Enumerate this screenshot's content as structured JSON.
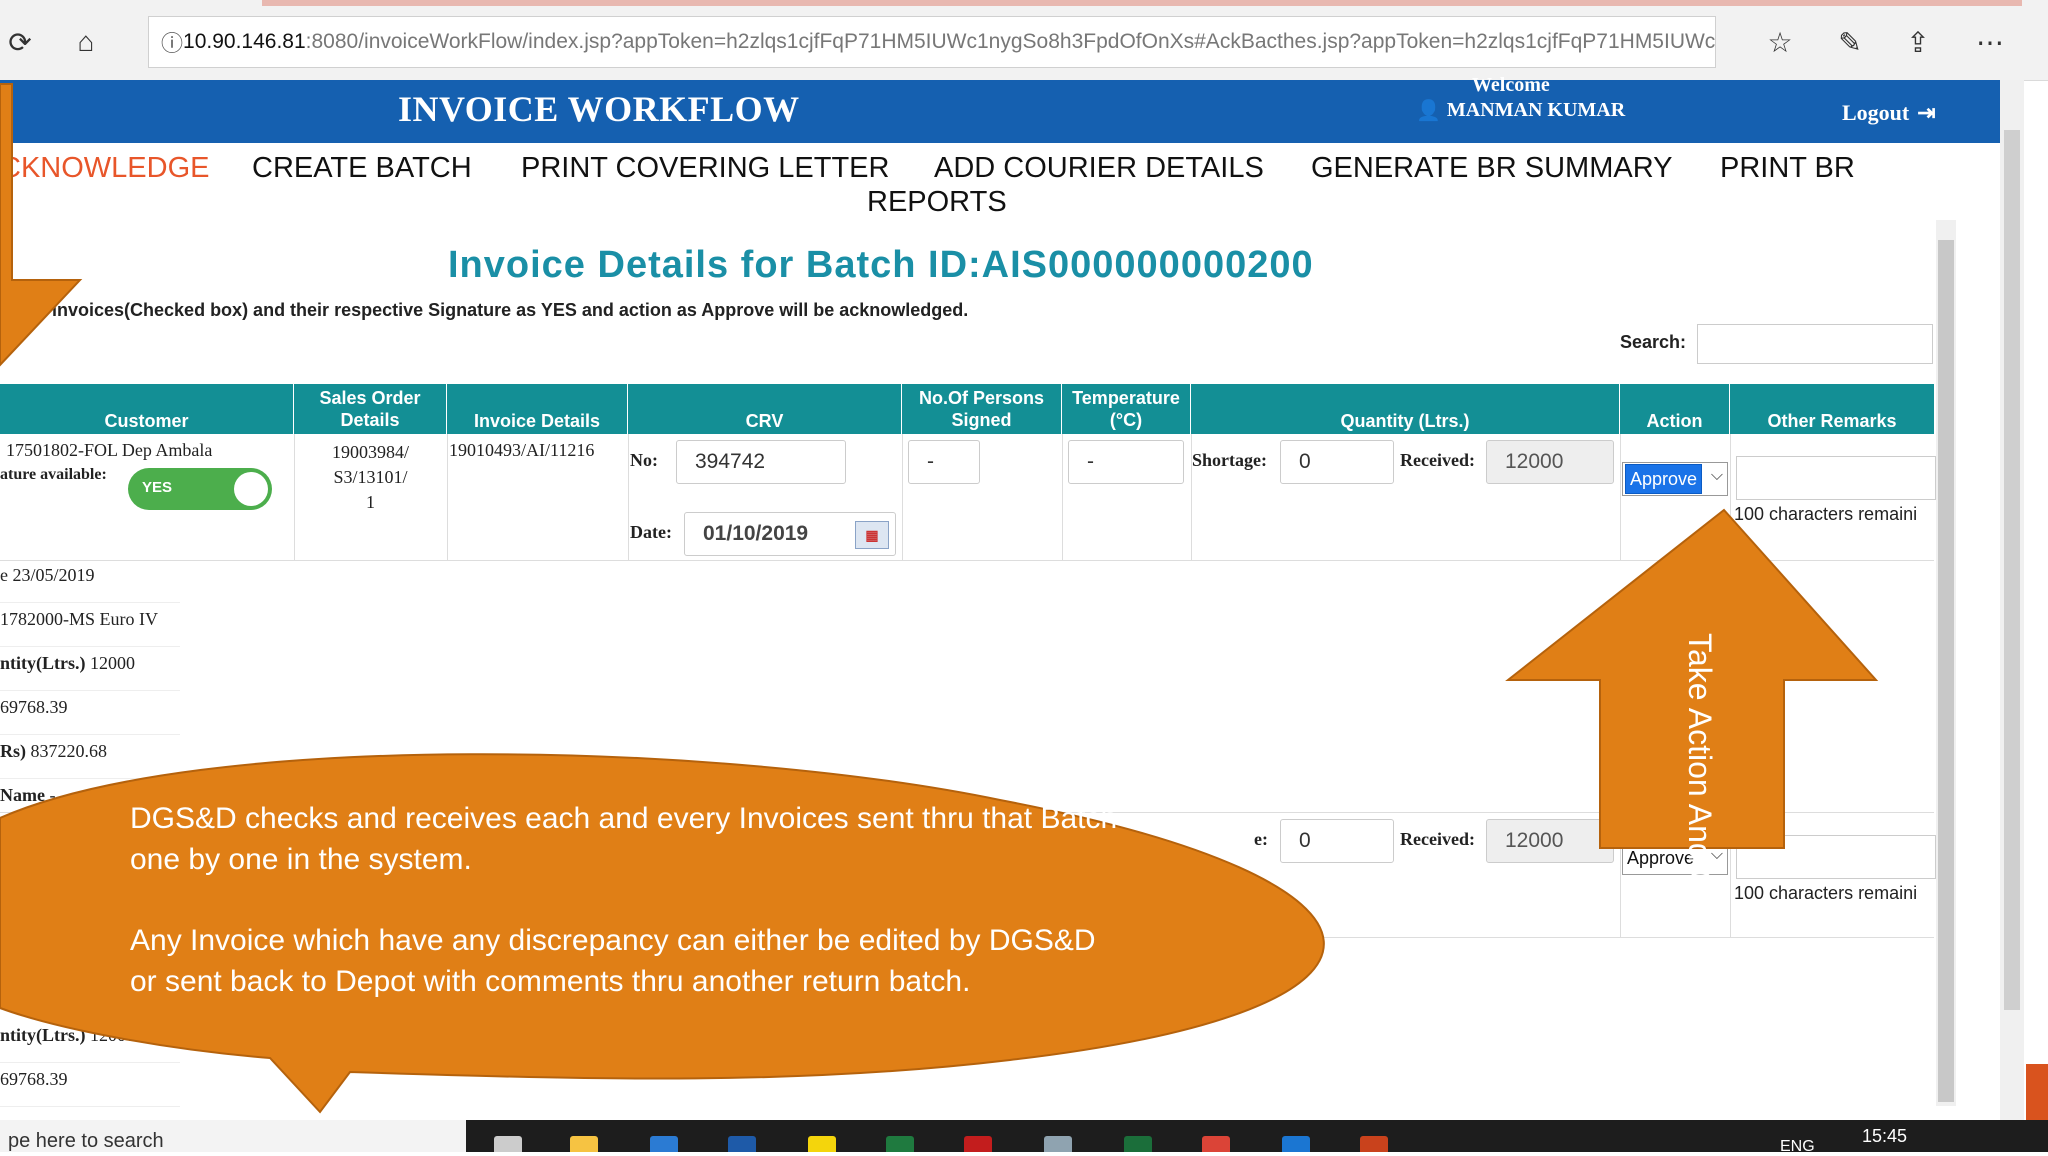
{
  "browser": {
    "url_host": "10.90.146.81",
    "url_rest": ":8080/invoiceWorkFlow/index.jsp?appToken=h2zlqs1cjfFqP71HM5IUWc1nygSo8h3FpdOfOnXs#AckBacthes.jsp?appToken=h2zlqs1cjfFqP71HM5IUWc1r",
    "icons": [
      "refresh-icon",
      "home-icon",
      "info-icon",
      "favorites-icon",
      "pen-icon",
      "share-icon",
      "more-icon"
    ]
  },
  "header": {
    "title": "INVOICE WORKFLOW",
    "welcome": "Welcome",
    "user": "MANMAN KUMAR",
    "logout": "Logout"
  },
  "nav": {
    "items": [
      "CKNOWLEDGE",
      "CREATE BATCH",
      "PRINT COVERING LETTER",
      "ADD COURIER DETAILS",
      "GENERATE BR SUMMARY",
      "PRINT BR",
      "REPORTS"
    ]
  },
  "page": {
    "heading": "Invoice Details for Batch ID:AIS000000000200",
    "instruction": "invoices(Checked box) and their respective Signature as YES and action as Approve will be acknowledged.",
    "search_label": "Search:"
  },
  "table": {
    "headers": [
      "Customer",
      "Sales Order Details",
      "Invoice Details",
      "CRV",
      "No.Of Persons Signed",
      "Temperature (°C)",
      "Quantity (Ltrs.)",
      "Action",
      "Other Remarks"
    ],
    "row1": {
      "customer": "17501802-FOL Dep Ambala",
      "signature_label": "ature available:",
      "signature_toggle": "YES",
      "sales_order_lines": [
        "19003984/",
        "S3/13101/",
        "1"
      ],
      "invoice": "19010493/AI/11216",
      "crv_no_label": "No:",
      "crv_no": "394742",
      "date_label": "Date:",
      "date": "01/10/2019",
      "persons_signed": "-",
      "temperature": "-",
      "shortage_label": "Shortage:",
      "shortage": "0",
      "received_label": "Received:",
      "received": "12000",
      "action": "Approve",
      "chars_remaining": "100 characters remaini"
    },
    "detail_lines": [
      {
        "prefix": "e ",
        "value": "23/05/2019"
      },
      {
        "prefix": "",
        "value": "1782000-MS Euro IV"
      },
      {
        "prefix": "ntity(Ltrs.) ",
        "value": "12000"
      },
      {
        "prefix": "",
        "value": "69768.39"
      },
      {
        "prefix": "Rs) ",
        "value": "837220.68"
      },
      {
        "prefix": "Name ",
        "value": "-"
      }
    ],
    "row2": {
      "shortage_label": "e:",
      "shortage": "0",
      "received_label": "Received:",
      "received": "12000",
      "action": "Approve",
      "chars_remaining": "100 characters remaini"
    },
    "row2_details": [
      {
        "prefix": "ntity(Ltrs.) ",
        "value": "12000"
      },
      {
        "prefix": "",
        "value": "69768.39"
      }
    ]
  },
  "callout": {
    "line1": " DGS&D checks and receives each and every Invoices sent thru that Batch one by one in the system.",
    "line2": "Any Invoice which have any discrepancy can either be edited by DGS&D or sent back to Depot with comments thru another return batch.",
    "color": "#e07f16"
  },
  "arrow_note": {
    "text": "Take Action And Give remarks"
  },
  "taskbar": {
    "search": "pe here to search",
    "language": "ENG",
    "time": "15:45"
  }
}
